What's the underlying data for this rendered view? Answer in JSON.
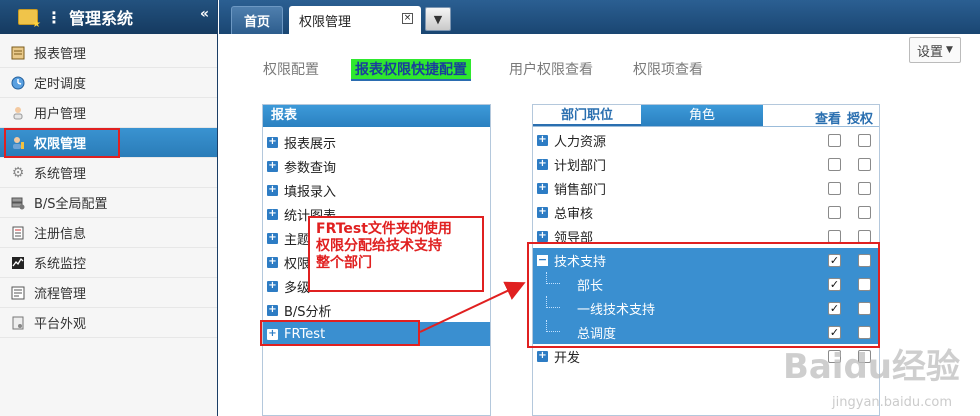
{
  "sidebar": {
    "title": "管理系统",
    "items": [
      {
        "label": "报表管理",
        "icon": "report-icon"
      },
      {
        "label": "定时调度",
        "icon": "clock-icon"
      },
      {
        "label": "用户管理",
        "icon": "user-icon"
      },
      {
        "label": "权限管理",
        "icon": "key-user-icon"
      },
      {
        "label": "系统管理",
        "icon": "gear-icon"
      },
      {
        "label": "B/S全局配置",
        "icon": "server-icon"
      },
      {
        "label": "注册信息",
        "icon": "register-icon"
      },
      {
        "label": "系统监控",
        "icon": "monitor-icon"
      },
      {
        "label": "流程管理",
        "icon": "flow-icon"
      },
      {
        "label": "平台外观",
        "icon": "appearance-icon"
      }
    ]
  },
  "tabs": {
    "home": "首页",
    "active": "权限管理",
    "close": "⊠"
  },
  "settings_label": "设置",
  "subtabs": [
    "权限配置",
    "报表权限快捷配置",
    "用户权限查看",
    "权限项查看"
  ],
  "report_panel": {
    "header": "报表",
    "items": [
      "报表展示",
      "参数查询",
      "填报录入",
      "统计图表",
      "主题",
      "权限",
      "多级",
      "B/S分析",
      "FRTest"
    ]
  },
  "perm_panel": {
    "tab_dept": "部门职位",
    "tab_role": "角色",
    "col_view": "查看",
    "col_grant": "授权",
    "items": [
      {
        "label": "人力资源",
        "view": false,
        "grant": false
      },
      {
        "label": "计划部门",
        "view": false,
        "grant": false
      },
      {
        "label": "销售部门",
        "view": false,
        "grant": false
      },
      {
        "label": "总审核",
        "view": false,
        "grant": false
      },
      {
        "label": "领导部",
        "view": false,
        "grant": false
      },
      {
        "label": "技术支持",
        "view": true,
        "grant": false
      },
      {
        "label": "部长",
        "view": true,
        "grant": false
      },
      {
        "label": "一线技术支持",
        "view": true,
        "grant": false
      },
      {
        "label": "总调度",
        "view": true,
        "grant": false
      },
      {
        "label": "开发",
        "view": false,
        "grant": false
      }
    ]
  },
  "callout": {
    "line1": "FRTest文件夹的使用",
    "line2": "权限分配给技术支持",
    "line3": "整个部门"
  },
  "watermark": {
    "brand": "Baidu经验",
    "url": "jingyan.baidu.com"
  },
  "colors": {
    "sidebar_header": "#1b4a78",
    "selection_blue": "#3a8fd0",
    "highlight_green": "#2ee82e",
    "annotation_red": "#e02020"
  }
}
